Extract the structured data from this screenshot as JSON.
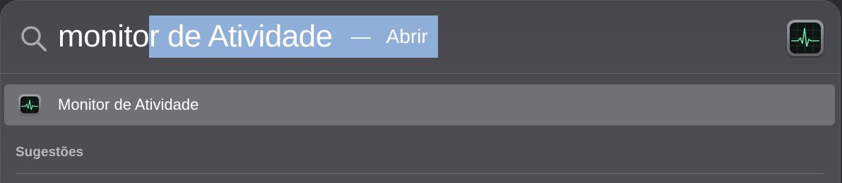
{
  "search": {
    "typed_text": "monito",
    "completion_text": "r de Atividade",
    "separator": "—",
    "action_label": "Abrir",
    "highlight_color": "#8fafd8"
  },
  "top_hit_icon": "activity-monitor-app-icon",
  "results": [
    {
      "label": "Monitor de Atividade",
      "icon": "activity-monitor-app-icon",
      "selected": true
    }
  ],
  "sections": {
    "suggestions_label": "Sugestões"
  }
}
